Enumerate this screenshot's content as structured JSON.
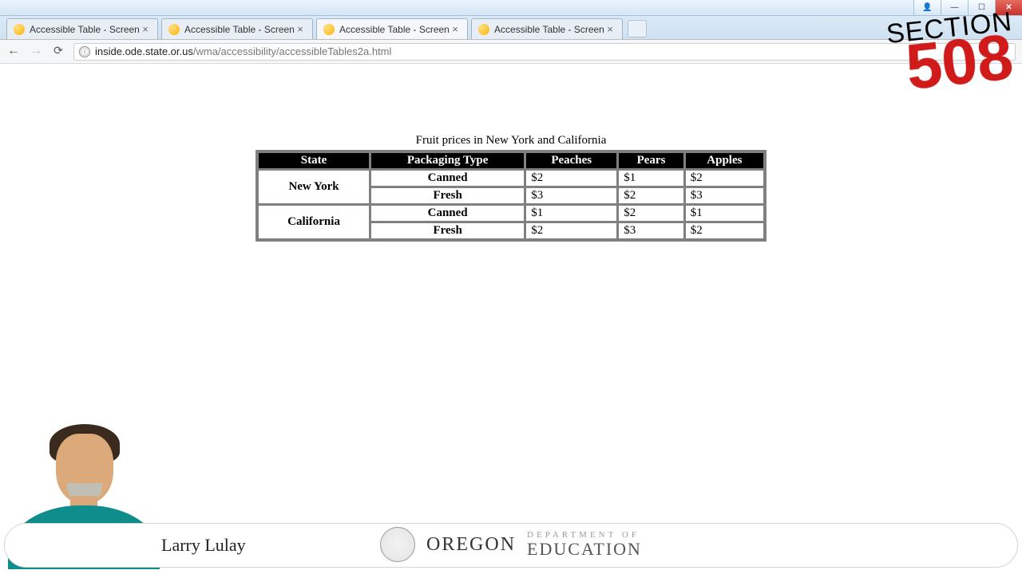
{
  "window": {
    "user_icon": "👤",
    "minimize": "—",
    "maximize": "☐",
    "close": "✕"
  },
  "tabs": {
    "items": [
      {
        "title": "Accessible Table - Screen",
        "active": false
      },
      {
        "title": "Accessible Table - Screen",
        "active": false
      },
      {
        "title": "Accessible Table - Screen",
        "active": true
      },
      {
        "title": "Accessible Table - Screen",
        "active": false
      }
    ],
    "close_glyph": "×",
    "new_tab_glyph": " "
  },
  "toolbar": {
    "back_glyph": "←",
    "forward_glyph": "→",
    "reload_glyph": "⟳",
    "info_glyph": "ⓘ",
    "url_host": "inside.ode.state.or.us",
    "url_path": "/wma/accessibility/accessibleTables2a.html"
  },
  "page": {
    "caption": "Fruit prices in New York and California",
    "headers": {
      "state": "State",
      "pkg": "Packaging Type",
      "peaches": "Peaches",
      "pears": "Pears",
      "apples": "Apples"
    },
    "rows": [
      {
        "state": "New York",
        "pkg": "Canned",
        "peaches": "$2",
        "pears": "$1",
        "apples": "$2",
        "first": true
      },
      {
        "state": "",
        "pkg": "Fresh",
        "peaches": "$3",
        "pears": "$2",
        "apples": "$3",
        "first": false
      },
      {
        "state": "California",
        "pkg": "Canned",
        "peaches": "$1",
        "pears": "$2",
        "apples": "$1",
        "first": true
      },
      {
        "state": "",
        "pkg": "Fresh",
        "peaches": "$2",
        "pears": "$3",
        "apples": "$2",
        "first": false
      }
    ]
  },
  "overlay": {
    "section_label": "SECTION",
    "section_number": "508",
    "presenter": "Larry Lulay",
    "org_state": "OREGON",
    "org_line1": "DEPARTMENT OF",
    "org_line2": "EDUCATION"
  }
}
